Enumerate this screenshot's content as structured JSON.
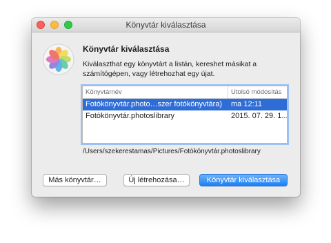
{
  "window": {
    "title": "Könyvtár kiválasztása"
  },
  "dialog": {
    "heading": "Könyvtár kiválasztása",
    "description": "Kiválaszthat egy könyvtárt a listán, kereshet másikat a számítógépen, vagy létrehozhat egy újat.",
    "app_icon": "photos-app-icon"
  },
  "library_list": {
    "columns": [
      "Könyvtárnév",
      "Utolsó módosítás"
    ],
    "rows": [
      {
        "name": "Fotókönyvtár.photo…szer fotókönyvtára)",
        "modified": "ma 12:11",
        "selected": true
      },
      {
        "name": "Fotókönyvtár.photoslibrary",
        "modified": "2015. 07. 29. 1...",
        "selected": false
      }
    ]
  },
  "selected_path": "/Users/szekerestamas/Pictures/Fotókönyvtár.photoslibrary",
  "buttons": {
    "other_library": "Más könyvtár…",
    "create_new": "Új létrehozása…",
    "choose_library": "Könyvtár kiválasztása"
  },
  "colors": {
    "selection": "#2f6dd6",
    "primary_button": "#1c7ff5",
    "close": "#fc605c",
    "minimize": "#fdbc40",
    "zoom": "#34c84a"
  }
}
